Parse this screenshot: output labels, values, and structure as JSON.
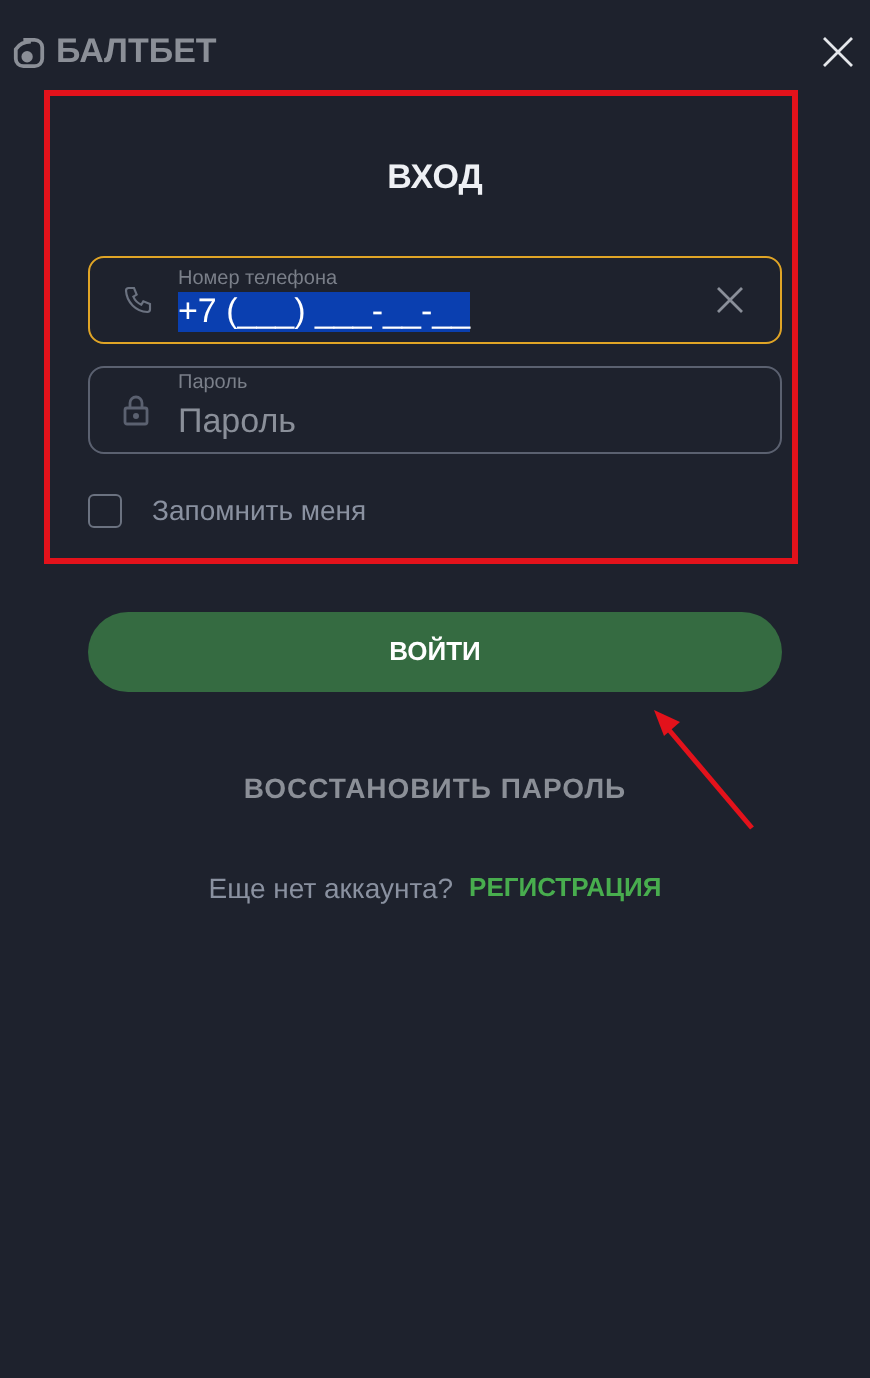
{
  "header": {
    "logo": "БАЛТБЕТ"
  },
  "form": {
    "title": "ВХОД",
    "fields": [
      {
        "kind": "phone",
        "label": "Номер телефона",
        "value": "+7 (___) ___-__-__",
        "focused": true,
        "selected": true
      },
      {
        "kind": "password",
        "label": "Пароль",
        "placeholder": "Пароль",
        "focused": false
      }
    ],
    "remember": {
      "label": "Запомнить меня",
      "checked": false
    },
    "submit": "ВОЙТИ",
    "restore": "ВОССТАНОВИТЬ ПАРОЛЬ",
    "register_prompt": "Еще нет аккаунта?",
    "register_link": "РЕГИСТРАЦИЯ"
  }
}
